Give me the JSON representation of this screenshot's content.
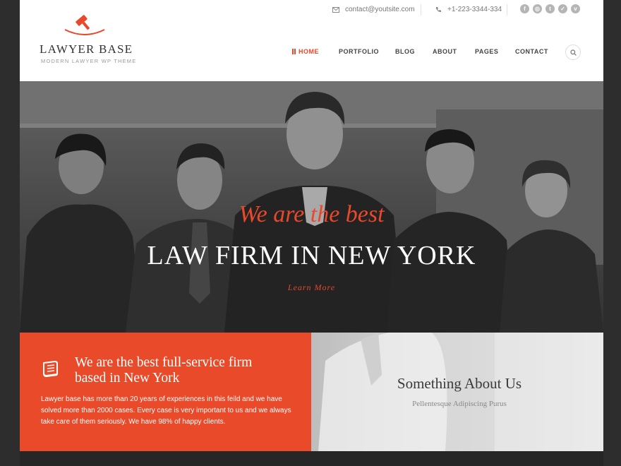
{
  "header": {
    "logo_title": "LAWYER BASE",
    "logo_tagline": "MODERN LAWYER WP THEME",
    "email": "contact@youtsite.com",
    "phone": "+1-223-3344-334",
    "socials": [
      {
        "name": "facebook-icon",
        "glyph": "f"
      },
      {
        "name": "instagram-icon",
        "glyph": "◎"
      },
      {
        "name": "tumblr-icon",
        "glyph": "t"
      },
      {
        "name": "twitter-icon",
        "glyph": "✓"
      },
      {
        "name": "vimeo-icon",
        "glyph": "v"
      }
    ]
  },
  "nav": {
    "items": [
      "HOME",
      "PORTFOLIO",
      "BLOG",
      "ABOUT",
      "PAGES",
      "CONTACT"
    ],
    "active": "HOME"
  },
  "hero": {
    "kicker": "We are the best",
    "title": "LAW FIRM IN NEW YORK",
    "link": "Learn More"
  },
  "feature": {
    "title": "We are the best full-service firm based in New York",
    "text": "Lawyer base has more than 20 years of experiences in this feild and we have solved more than 2000 cases.  Every case is very important to us and we always take care of them seriously. We have 98% of happy clients."
  },
  "about": {
    "title": "Something About Us",
    "subtitle": "Pellentesque Adipiscing Purus"
  },
  "colors": {
    "accent": "#e8482b",
    "dark_background": "#2d2d2d"
  }
}
